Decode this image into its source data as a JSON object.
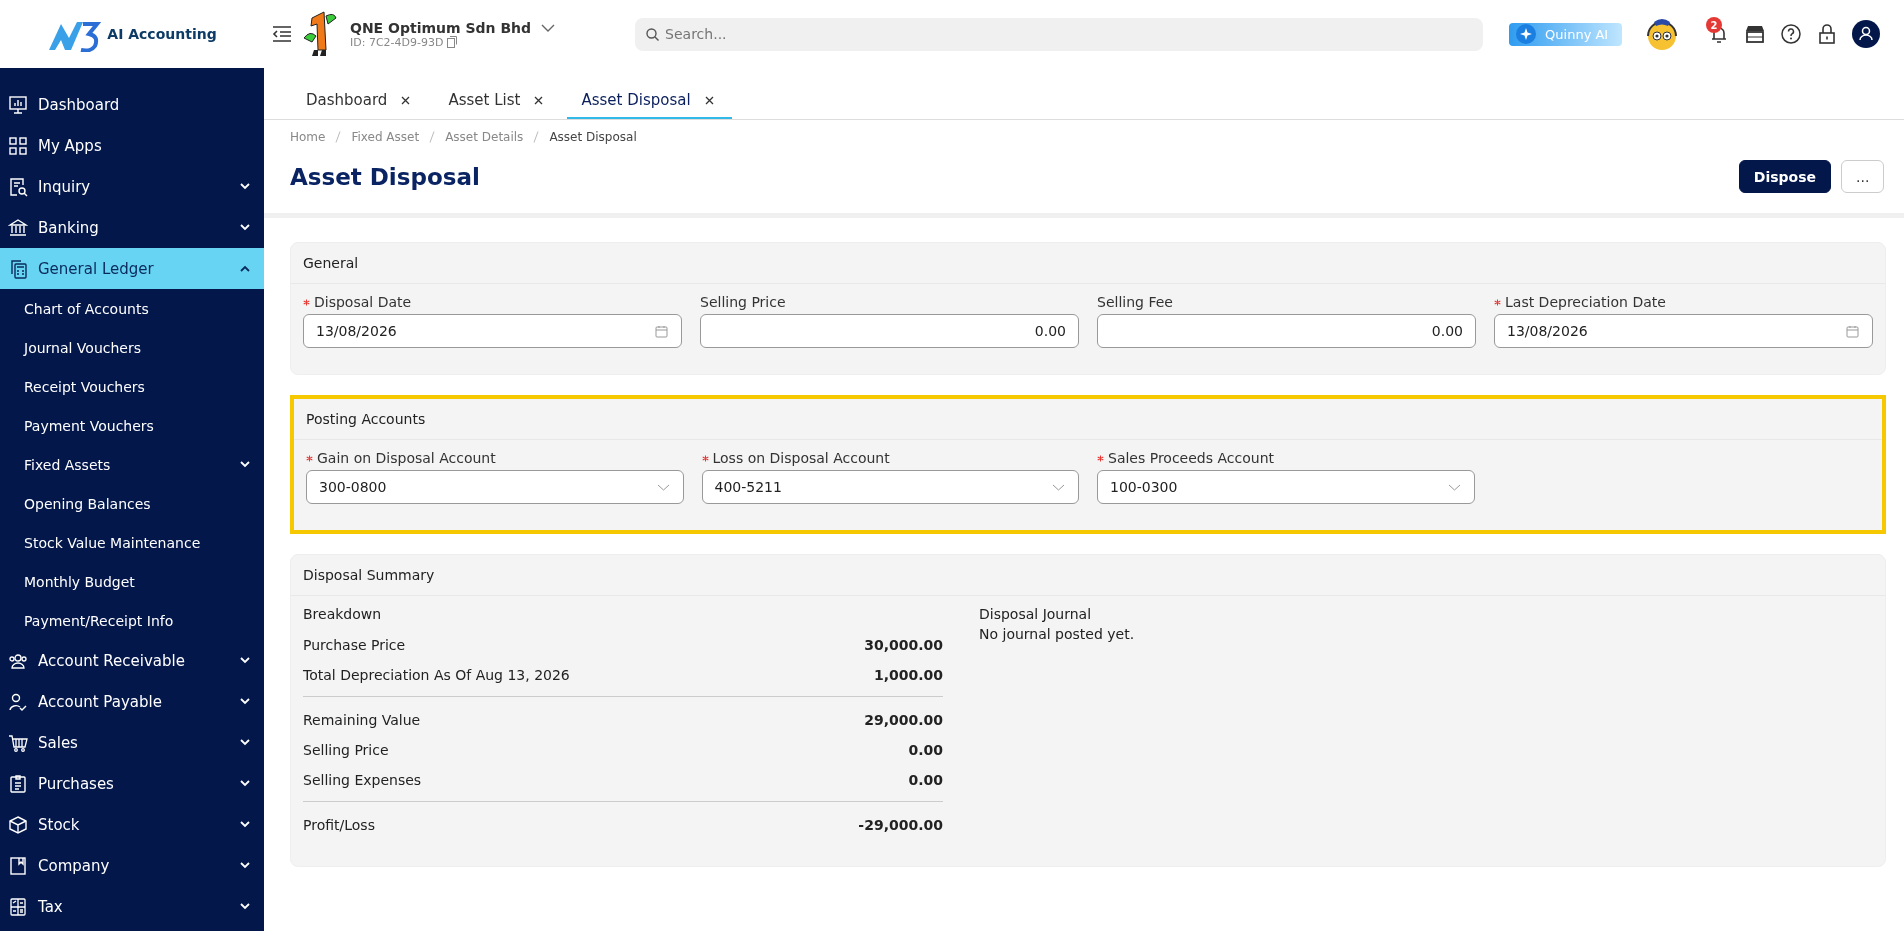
{
  "header": {
    "logo_text": "AI Accounting",
    "company": {
      "name": "QNE Optimum Sdn Bhd",
      "id": "ID: 7C2-4D9-93D"
    },
    "search": {
      "placeholder": "Search..."
    },
    "ai_button": "Quinny AI",
    "notification_count": "2"
  },
  "sidebar": {
    "items": [
      {
        "label": "Dashboard",
        "selected": false
      },
      {
        "label": "My Apps",
        "selected": false
      },
      {
        "label": "Inquiry",
        "selected": false,
        "expanded": false
      },
      {
        "label": "Banking",
        "selected": false,
        "expanded": false
      },
      {
        "label": "General Ledger",
        "selected": true,
        "expanded": true,
        "children": [
          {
            "label": "Chart of Accounts",
            "selected": false
          },
          {
            "label": "Journal Vouchers",
            "selected": false
          },
          {
            "label": "Receipt Vouchers",
            "selected": false
          },
          {
            "label": "Payment Vouchers",
            "selected": false
          },
          {
            "label": "Fixed Assets",
            "selected": false,
            "expanded": false
          },
          {
            "label": "Opening Balances",
            "selected": false
          },
          {
            "label": "Stock Value Maintenance",
            "selected": false
          },
          {
            "label": "Monthly Budget",
            "selected": false
          },
          {
            "label": "Payment/Receipt Info",
            "selected": false
          }
        ]
      },
      {
        "label": "Account Receivable",
        "selected": false,
        "expanded": false
      },
      {
        "label": "Account Payable",
        "selected": false,
        "expanded": false
      },
      {
        "label": "Sales",
        "selected": false,
        "expanded": false
      },
      {
        "label": "Purchases",
        "selected": false,
        "expanded": false
      },
      {
        "label": "Stock",
        "selected": false,
        "expanded": false
      },
      {
        "label": "Company",
        "selected": false,
        "expanded": false
      },
      {
        "label": "Tax",
        "selected": false,
        "expanded": false
      }
    ]
  },
  "tabs": [
    {
      "label": "Dashboard",
      "selected": false
    },
    {
      "label": "Asset List",
      "selected": false
    },
    {
      "label": "Asset Disposal",
      "selected": true
    }
  ],
  "breadcrumb": [
    "Home",
    "Fixed Asset",
    "Asset Details",
    "Asset Disposal"
  ],
  "page": {
    "title": "Asset Disposal",
    "buttons": [
      {
        "label": "Dispose",
        "kind": "primary"
      },
      {
        "label": "...",
        "kind": "secondary"
      }
    ]
  },
  "sections": [
    {
      "title": "General",
      "highlighted": false,
      "fields": [
        {
          "label": "Disposal Date",
          "required": true,
          "kind": "date",
          "value": "13/08/2026"
        },
        {
          "label": "Selling Price",
          "required": false,
          "kind": "number",
          "value": "0.00"
        },
        {
          "label": "Selling Fee",
          "required": false,
          "kind": "number",
          "value": "0.00"
        },
        {
          "label": "Last Depreciation Date",
          "required": true,
          "kind": "date",
          "value": "13/08/2026"
        }
      ]
    },
    {
      "title": "Posting Accounts",
      "highlighted": true,
      "fields": [
        {
          "label": "Gain on Disposal Account",
          "required": true,
          "kind": "select",
          "value": "300-0800"
        },
        {
          "label": "Loss on Disposal Account",
          "required": true,
          "kind": "select",
          "value": "400-5211"
        },
        {
          "label": "Sales Proceeds Account",
          "required": true,
          "kind": "select",
          "value": "100-0300"
        }
      ]
    }
  ],
  "summary": {
    "title": "Disposal Summary",
    "breakdown": {
      "title": "Breakdown",
      "groups": [
        [
          {
            "label": "Purchase Price",
            "value": "30,000.00"
          },
          {
            "label": "Total Depreciation As Of Aug 13, 2026",
            "value": "1,000.00"
          }
        ],
        [
          {
            "label": "Remaining Value",
            "value": "29,000.00"
          },
          {
            "label": "Selling Price",
            "value": "0.00"
          },
          {
            "label": "Selling Expenses",
            "value": "0.00"
          }
        ],
        [
          {
            "label": "Profit/Loss",
            "value": "-29,000.00"
          }
        ]
      ]
    },
    "journal": {
      "title": "Disposal Journal",
      "message": "No journal posted yet."
    }
  }
}
